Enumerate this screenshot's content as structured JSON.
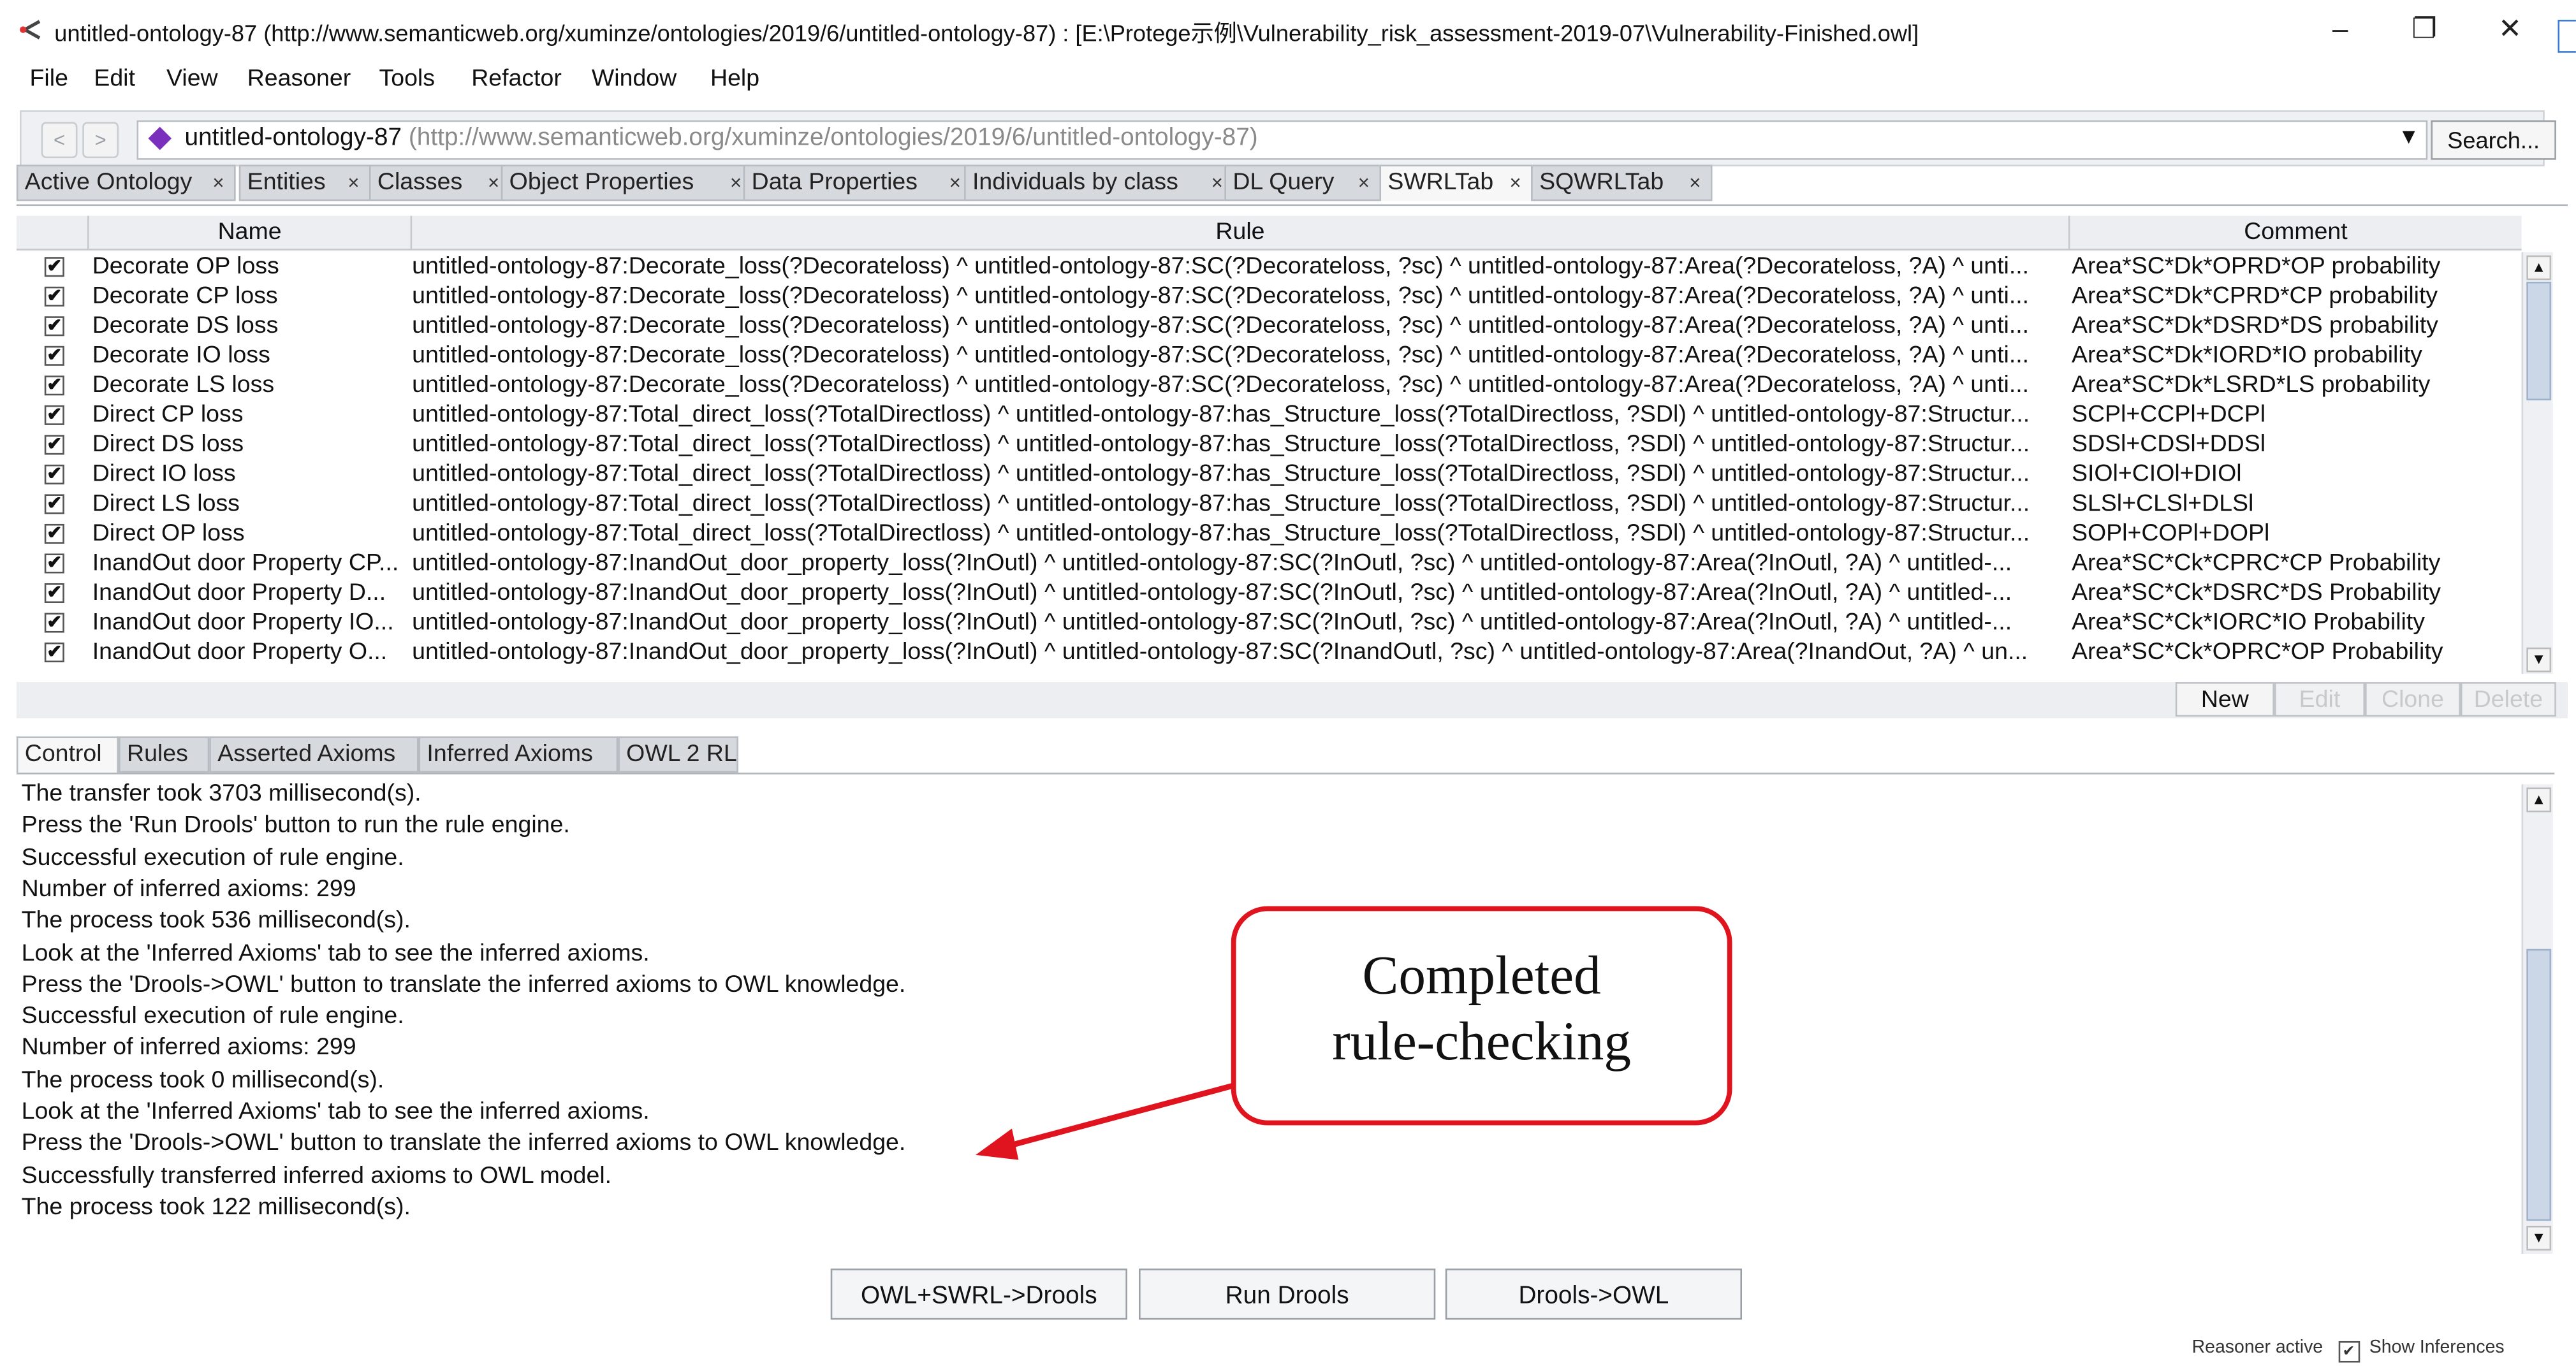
{
  "window": {
    "title": "untitled-ontology-87 (http://www.semanticweb.org/xuminze/ontologies/2019/6/untitled-ontology-87)  : [E:\\Protege示例\\Vulnerability_risk_assessment-2019-07\\Vulnerability-Finished.owl]",
    "minimize": "–",
    "restore": "❐",
    "close": "✕"
  },
  "menu": [
    "File",
    "Edit",
    "View",
    "Reasoner",
    "Tools",
    "Refactor",
    "Window",
    "Help"
  ],
  "address": {
    "back": "<",
    "forward": ">",
    "ontology_name": "untitled-ontology-87",
    "ontology_iri": "(http://www.semanticweb.org/xuminze/ontologies/2019/6/untitled-ontology-87)",
    "dropdown": "▼",
    "search_label": "Search..."
  },
  "tabs": [
    {
      "label": "Active Ontology",
      "close": "×"
    },
    {
      "label": "Entities",
      "close": "×"
    },
    {
      "label": "Classes",
      "close": "×"
    },
    {
      "label": "Object Properties",
      "close": "×"
    },
    {
      "label": "Data Properties",
      "close": "×"
    },
    {
      "label": "Individuals by class",
      "close": "×"
    },
    {
      "label": "DL Query",
      "close": "×"
    },
    {
      "label": "SWRLTab",
      "close": "×"
    },
    {
      "label": "SQWRLTab",
      "close": "×"
    }
  ],
  "rules_table": {
    "headers": {
      "name": "Name",
      "rule": "Rule",
      "comment": "Comment"
    },
    "rows": [
      {
        "checked": "✔",
        "name": "Decorate  OP loss",
        "rule": "untitled-ontology-87:Decorate_loss(?Decorateloss) ^ untitled-ontology-87:SC(?Decorateloss, ?sc) ^ untitled-ontology-87:Area(?Decorateloss, ?A) ^ unti...",
        "comment": "Area*SC*Dk*OPRD*OP probability"
      },
      {
        "checked": "✔",
        "name": "Decorate CP loss",
        "rule": "untitled-ontology-87:Decorate_loss(?Decorateloss) ^ untitled-ontology-87:SC(?Decorateloss, ?sc) ^ untitled-ontology-87:Area(?Decorateloss, ?A) ^ unti...",
        "comment": "Area*SC*Dk*CPRD*CP probability"
      },
      {
        "checked": "✔",
        "name": "Decorate DS loss",
        "rule": "untitled-ontology-87:Decorate_loss(?Decorateloss) ^ untitled-ontology-87:SC(?Decorateloss, ?sc) ^ untitled-ontology-87:Area(?Decorateloss, ?A) ^ unti...",
        "comment": "Area*SC*Dk*DSRD*DS probability"
      },
      {
        "checked": "✔",
        "name": "Decorate IO loss",
        "rule": "untitled-ontology-87:Decorate_loss(?Decorateloss) ^ untitled-ontology-87:SC(?Decorateloss, ?sc) ^ untitled-ontology-87:Area(?Decorateloss, ?A) ^ unti...",
        "comment": "Area*SC*Dk*IORD*IO probability"
      },
      {
        "checked": "✔",
        "name": "Decorate LS loss",
        "rule": "untitled-ontology-87:Decorate_loss(?Decorateloss) ^ untitled-ontology-87:SC(?Decorateloss, ?sc) ^ untitled-ontology-87:Area(?Decorateloss, ?A) ^ unti...",
        "comment": "Area*SC*Dk*LSRD*LS probability"
      },
      {
        "checked": "✔",
        "name": "Direct CP loss",
        "rule": "untitled-ontology-87:Total_direct_loss(?TotalDirectloss) ^ untitled-ontology-87:has_Structure_loss(?TotalDirectloss, ?SDl) ^ untitled-ontology-87:Structur...",
        "comment": "SCPl+CCPl+DCPl"
      },
      {
        "checked": "✔",
        "name": "Direct DS loss",
        "rule": "untitled-ontology-87:Total_direct_loss(?TotalDirectloss) ^ untitled-ontology-87:has_Structure_loss(?TotalDirectloss, ?SDl) ^ untitled-ontology-87:Structur...",
        "comment": "SDSl+CDSl+DDSl"
      },
      {
        "checked": "✔",
        "name": "Direct IO loss",
        "rule": "untitled-ontology-87:Total_direct_loss(?TotalDirectloss) ^ untitled-ontology-87:has_Structure_loss(?TotalDirectloss, ?SDl) ^ untitled-ontology-87:Structur...",
        "comment": "SIOl+CIOl+DIOl"
      },
      {
        "checked": "✔",
        "name": "Direct LS loss",
        "rule": "untitled-ontology-87:Total_direct_loss(?TotalDirectloss) ^ untitled-ontology-87:has_Structure_loss(?TotalDirectloss, ?SDl) ^ untitled-ontology-87:Structur...",
        "comment": "SLSl+CLSl+DLSl"
      },
      {
        "checked": "✔",
        "name": "Direct OP loss",
        "rule": "untitled-ontology-87:Total_direct_loss(?TotalDirectloss) ^ untitled-ontology-87:has_Structure_loss(?TotalDirectloss, ?SDl) ^ untitled-ontology-87:Structur...",
        "comment": "SOPl+COPl+DOPl"
      },
      {
        "checked": "✔",
        "name": "InandOut door Property CP...",
        "rule": "untitled-ontology-87:InandOut_door_property_loss(?InOutl) ^ untitled-ontology-87:SC(?InOutl, ?sc) ^ untitled-ontology-87:Area(?InOutl, ?A) ^ untitled-...",
        "comment": "Area*SC*Ck*CPRC*CP Probability"
      },
      {
        "checked": "✔",
        "name": "InandOut door Property D...",
        "rule": "untitled-ontology-87:InandOut_door_property_loss(?InOutl) ^ untitled-ontology-87:SC(?InOutl, ?sc) ^ untitled-ontology-87:Area(?InOutl, ?A) ^ untitled-...",
        "comment": "Area*SC*Ck*DSRC*DS Probability"
      },
      {
        "checked": "✔",
        "name": "InandOut door Property IO...",
        "rule": "untitled-ontology-87:InandOut_door_property_loss(?InOutl) ^ untitled-ontology-87:SC(?InOutl, ?sc) ^ untitled-ontology-87:Area(?InOutl, ?A) ^ untitled-...",
        "comment": "Area*SC*Ck*IORC*IO Probability"
      },
      {
        "checked": "✔",
        "name": "InandOut door Property O...",
        "rule": "untitled-ontology-87:InandOut_door_property_loss(?InOutl) ^ untitled-ontology-87:SC(?InandOutl, ?sc) ^ untitled-ontology-87:Area(?InandOut, ?A) ^ un...",
        "comment": "Area*SC*Ck*OPRC*OP Probability"
      }
    ],
    "actions": {
      "new": "New",
      "edit": "Edit",
      "clone": "Clone",
      "delete": "Delete"
    }
  },
  "sub_tabs": [
    "Control",
    "Rules",
    "Asserted Axioms",
    "Inferred Axioms",
    "OWL 2 RL"
  ],
  "log_lines": [
    "The transfer took 3703 millisecond(s).",
    "Press the 'Run Drools' button to run the rule engine.",
    "Successful execution of rule engine.",
    "Number of inferred axioms: 299",
    "The process took 536 millisecond(s).",
    "Look at the 'Inferred Axioms' tab to see the inferred axioms.",
    "Press the 'Drools->OWL' button to translate the inferred axioms to OWL knowledge.",
    "Successful execution of rule engine.",
    "Number of inferred axioms: 299",
    "The process took 0 millisecond(s).",
    "Look at the 'Inferred Axioms' tab to see the inferred axioms.",
    "Press the 'Drools->OWL' button to translate the inferred axioms to OWL knowledge.",
    "Successfully transferred inferred axioms to OWL model.",
    "The process took 122 millisecond(s)."
  ],
  "control_buttons": {
    "owl_swrl_drools": "OWL+SWRL->Drools",
    "run_drools": "Run Drools",
    "drools_owl": "Drools->OWL"
  },
  "annotation": {
    "line1": "Completed",
    "line2": "rule-checking",
    "color": "#e0141e"
  },
  "status": {
    "reasoner": "Reasoner active",
    "show_inferences": "Show Inferences",
    "checkbox": "✔"
  },
  "colors": {
    "ontology_diamond": "#7b2fbd",
    "tab_bg": "#d6d9dd",
    "scroll_thumb": "#cbd6e6"
  }
}
